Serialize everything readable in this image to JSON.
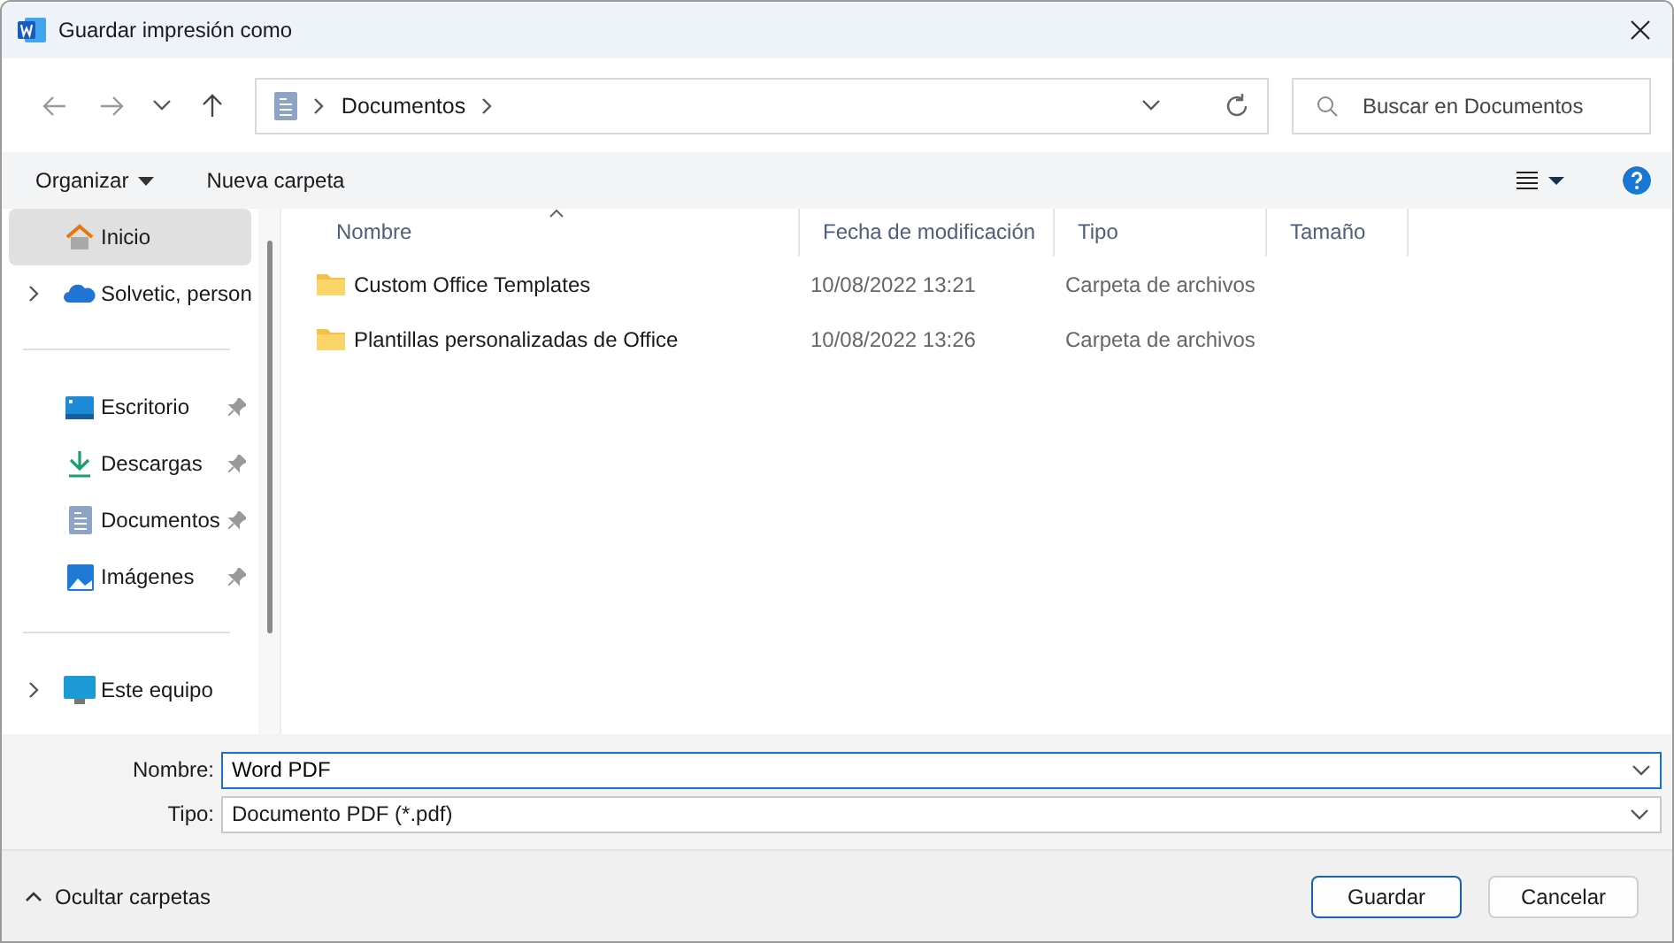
{
  "window": {
    "title": "Guardar impresión como"
  },
  "address": {
    "path": [
      {
        "label": "Documentos"
      }
    ]
  },
  "search": {
    "placeholder": "Buscar en Documentos"
  },
  "toolbar": {
    "organize": "Organizar",
    "new_folder": "Nueva carpeta"
  },
  "sidebar": {
    "items": [
      {
        "kind": "home",
        "label": "Inicio",
        "selected": true,
        "expandable": false,
        "pinned": false
      },
      {
        "kind": "cloud",
        "label": "Solvetic, person",
        "selected": false,
        "expandable": true,
        "pinned": false
      },
      {
        "kind": "divider"
      },
      {
        "kind": "desktop",
        "label": "Escritorio",
        "selected": false,
        "expandable": false,
        "pinned": true
      },
      {
        "kind": "download",
        "label": "Descargas",
        "selected": false,
        "expandable": false,
        "pinned": true
      },
      {
        "kind": "documents",
        "label": "Documentos",
        "selected": false,
        "expandable": false,
        "pinned": true
      },
      {
        "kind": "pictures",
        "label": "Imágenes",
        "selected": false,
        "expandable": false,
        "pinned": true
      },
      {
        "kind": "divider"
      },
      {
        "kind": "computer",
        "label": "Este equipo",
        "selected": false,
        "expandable": true,
        "pinned": false
      }
    ]
  },
  "table": {
    "columns": [
      {
        "label": "Nombre",
        "sorted": true
      },
      {
        "label": "Fecha de modificación",
        "sorted": false
      },
      {
        "label": "Tipo",
        "sorted": false
      },
      {
        "label": "Tamaño",
        "sorted": false
      }
    ],
    "rows": [
      {
        "name": "Custom Office Templates",
        "date": "10/08/2022 13:21",
        "type": "Carpeta de archivos"
      },
      {
        "name": "Plantillas personalizadas de Office",
        "date": "10/08/2022 13:26",
        "type": "Carpeta de archivos"
      }
    ]
  },
  "form": {
    "name": {
      "label": "Nombre:",
      "value": "Word PDF"
    },
    "type": {
      "label": "Tipo:",
      "value": "Documento PDF (*.pdf)"
    }
  },
  "footer": {
    "toggle": "Ocultar carpetas",
    "buttons": [
      {
        "label": "Guardar",
        "default": true
      },
      {
        "label": "Cancelar",
        "default": false
      }
    ]
  }
}
